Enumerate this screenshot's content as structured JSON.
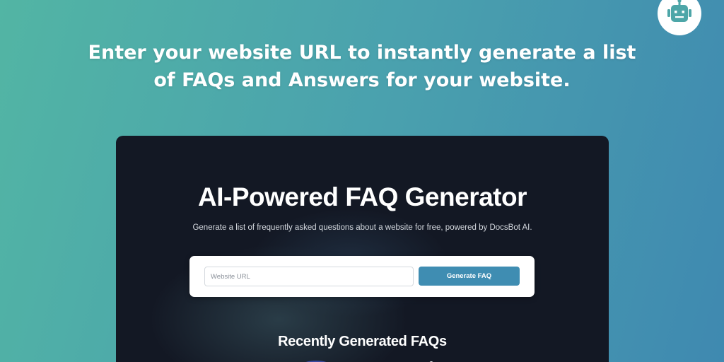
{
  "header": {
    "line1": "Enter your website URL to instantly generate a list",
    "line2": "of FAQs and Answers for your website."
  },
  "logo": {
    "icon": "robot-icon",
    "color": "#4da6a8"
  },
  "tool": {
    "title": "AI-Powered FAQ Generator",
    "subtitle": "Generate a list of frequently asked questions about a website for free, powered by DocsBot AI.",
    "url_placeholder": "Website URL",
    "url_value": "",
    "generate_label": "Generate FAQ",
    "recent_title": "Recently Generated FAQs"
  },
  "colors": {
    "accent": "#3f8db2",
    "panel_bg": "#131824",
    "gradient_start": "#52b5a4",
    "gradient_end": "#3f89b0"
  }
}
